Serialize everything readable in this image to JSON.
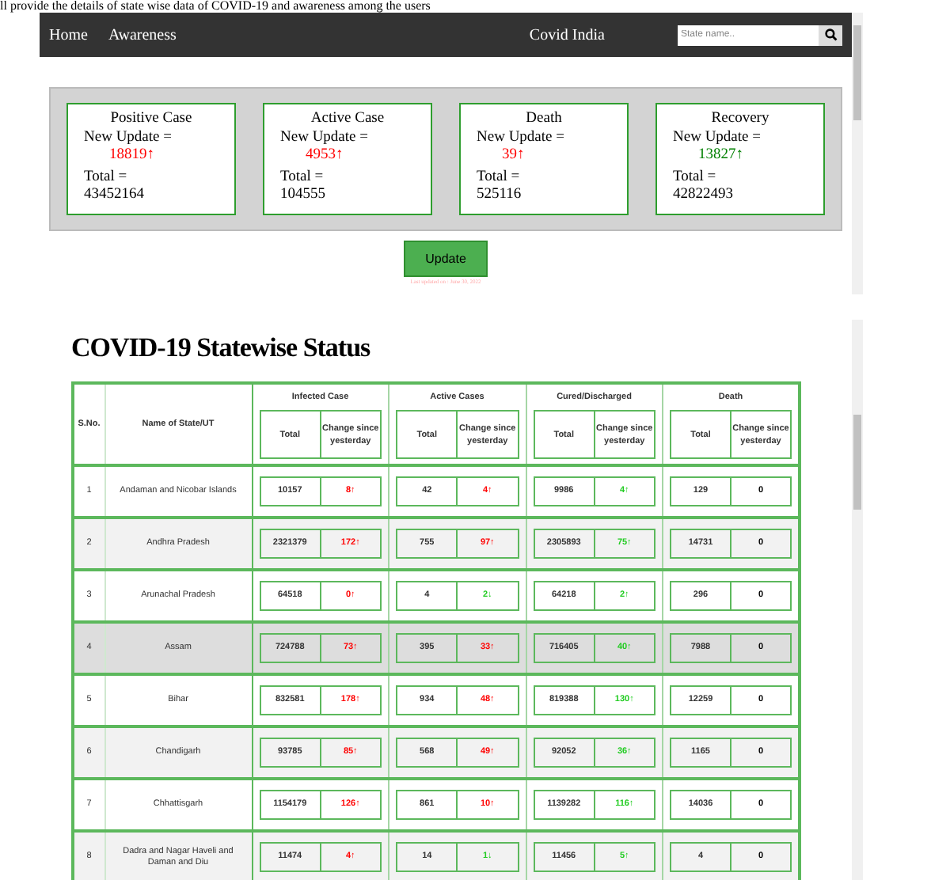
{
  "intro_text": "ll provide the details of state wise data of COVID-19 and awareness among the users",
  "nav": {
    "links": [
      "Home",
      "Awareness"
    ],
    "brand": "Covid India",
    "search": {
      "placeholder": "State name.."
    }
  },
  "summary_cards": [
    {
      "title": "Positive Case",
      "new_label": "New Update =",
      "new_value": "18819↑",
      "color": "#ff0000",
      "total_label": "Total =",
      "total_value": "43452164"
    },
    {
      "title": "Active Case",
      "new_label": "New Update =",
      "new_value": "4953↑",
      "color": "#ff0000",
      "total_label": "Total =",
      "total_value": "104555"
    },
    {
      "title": "Death",
      "new_label": "New Update =",
      "new_value": "39↑",
      "color": "#ff0000",
      "total_label": "Total =",
      "total_value": "525116"
    },
    {
      "title": "Recovery",
      "new_label": "New Update =",
      "new_value": "13827↑",
      "color": "#008000",
      "total_label": "Total =",
      "total_value": "42822493"
    }
  ],
  "update_button": "Update",
  "last_updated": "Last updated on : June 30, 2022",
  "table_title": "COVID-19 Statewise Status",
  "table": {
    "sno_header": "S.No.",
    "name_header": "Name of State/UT",
    "groups": [
      {
        "title": "Infected Case",
        "sub": [
          "Total",
          "Change since yesterday"
        ]
      },
      {
        "title": "Active Cases",
        "sub": [
          "Total",
          "Change since yesterday"
        ]
      },
      {
        "title": "Cured/Discharged",
        "sub": [
          "Total",
          "Change since yesterday"
        ]
      },
      {
        "title": "Death",
        "sub": [
          "Total",
          "Change since yesterday"
        ]
      }
    ],
    "rows": [
      {
        "sno": "1",
        "name": "Andaman and Nicobar Islands",
        "highlighted": false,
        "cells": [
          {
            "total": "10157",
            "change": "8↑",
            "color": "#ff0000"
          },
          {
            "total": "42",
            "change": "4↑",
            "color": "#ff0000"
          },
          {
            "total": "9986",
            "change": "4↑",
            "color": "#22cc22"
          },
          {
            "total": "129",
            "change": "0",
            "color": "#000000"
          }
        ]
      },
      {
        "sno": "2",
        "name": "Andhra Pradesh",
        "highlighted": false,
        "cells": [
          {
            "total": "2321379",
            "change": "172↑",
            "color": "#ff0000"
          },
          {
            "total": "755",
            "change": "97↑",
            "color": "#ff0000"
          },
          {
            "total": "2305893",
            "change": "75↑",
            "color": "#22cc22"
          },
          {
            "total": "14731",
            "change": "0",
            "color": "#000000"
          }
        ]
      },
      {
        "sno": "3",
        "name": "Arunachal Pradesh",
        "highlighted": false,
        "cells": [
          {
            "total": "64518",
            "change": "0↑",
            "color": "#ff0000"
          },
          {
            "total": "4",
            "change": "2↓",
            "color": "#22cc22"
          },
          {
            "total": "64218",
            "change": "2↑",
            "color": "#22cc22"
          },
          {
            "total": "296",
            "change": "0",
            "color": "#000000"
          }
        ]
      },
      {
        "sno": "4",
        "name": "Assam",
        "highlighted": true,
        "cells": [
          {
            "total": "724788",
            "change": "73↑",
            "color": "#ff0000"
          },
          {
            "total": "395",
            "change": "33↑",
            "color": "#ff0000"
          },
          {
            "total": "716405",
            "change": "40↑",
            "color": "#22cc22"
          },
          {
            "total": "7988",
            "change": "0",
            "color": "#000000"
          }
        ]
      },
      {
        "sno": "5",
        "name": "Bihar",
        "highlighted": false,
        "cells": [
          {
            "total": "832581",
            "change": "178↑",
            "color": "#ff0000"
          },
          {
            "total": "934",
            "change": "48↑",
            "color": "#ff0000"
          },
          {
            "total": "819388",
            "change": "130↑",
            "color": "#22cc22"
          },
          {
            "total": "12259",
            "change": "0",
            "color": "#000000"
          }
        ]
      },
      {
        "sno": "6",
        "name": "Chandigarh",
        "highlighted": false,
        "cells": [
          {
            "total": "93785",
            "change": "85↑",
            "color": "#ff0000"
          },
          {
            "total": "568",
            "change": "49↑",
            "color": "#ff0000"
          },
          {
            "total": "92052",
            "change": "36↑",
            "color": "#22cc22"
          },
          {
            "total": "1165",
            "change": "0",
            "color": "#000000"
          }
        ]
      },
      {
        "sno": "7",
        "name": "Chhattisgarh",
        "highlighted": false,
        "cells": [
          {
            "total": "1154179",
            "change": "126↑",
            "color": "#ff0000"
          },
          {
            "total": "861",
            "change": "10↑",
            "color": "#ff0000"
          },
          {
            "total": "1139282",
            "change": "116↑",
            "color": "#22cc22"
          },
          {
            "total": "14036",
            "change": "0",
            "color": "#000000"
          }
        ]
      },
      {
        "sno": "8",
        "name": "Dadra and Nagar Haveli and Daman and Diu",
        "highlighted": false,
        "cells": [
          {
            "total": "11474",
            "change": "4↑",
            "color": "#ff0000"
          },
          {
            "total": "14",
            "change": "1↓",
            "color": "#22cc22"
          },
          {
            "total": "11456",
            "change": "5↑",
            "color": "#22cc22"
          },
          {
            "total": "4",
            "change": "0",
            "color": "#000000"
          }
        ]
      }
    ]
  }
}
